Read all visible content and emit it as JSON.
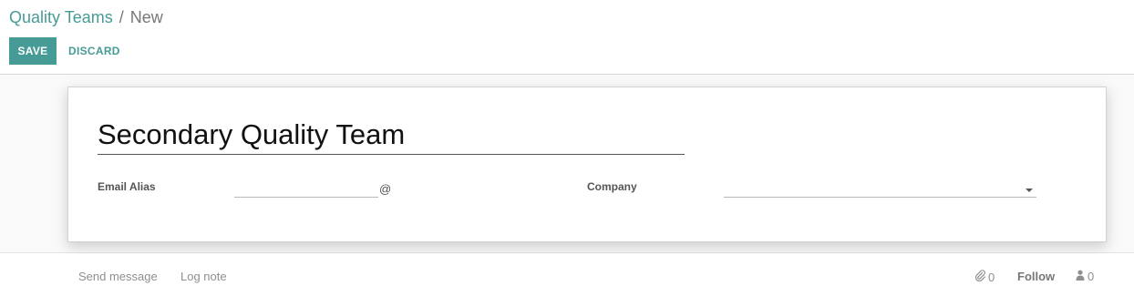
{
  "breadcrumb": {
    "parent": "Quality Teams",
    "separator": "/",
    "current": "New"
  },
  "toolbar": {
    "save_label": "SAVE",
    "discard_label": "DISCARD"
  },
  "form": {
    "name_value": "Secondary Quality Team",
    "email_alias_label": "Email Alias",
    "email_alias_value": "",
    "at_sign": "@",
    "company_label": "Company",
    "company_value": ""
  },
  "chatter": {
    "send_message_label": "Send message",
    "log_note_label": "Log note",
    "attachment_count": "0",
    "follow_label": "Follow",
    "follower_count": "0",
    "icons": {
      "attachment": "paperclip-icon",
      "followers": "user-icon"
    }
  },
  "colors": {
    "accent": "#479b96",
    "muted_text": "#8f8f8f"
  }
}
